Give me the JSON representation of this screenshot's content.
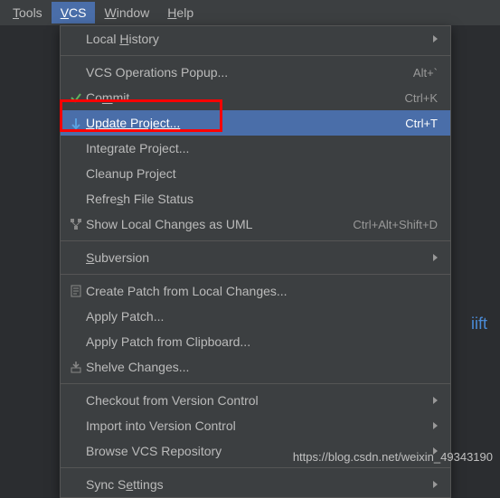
{
  "menubar": {
    "tools": "Tools",
    "vcs": "VCS",
    "window": "Window",
    "help": "Help"
  },
  "menu": {
    "local_history": "Local History",
    "vcs_ops_popup": "VCS Operations Popup...",
    "vcs_ops_popup_sc": "Alt+`",
    "commit": "Commit...",
    "commit_sc": "Ctrl+K",
    "update_project": "Update Project...",
    "update_project_sc": "Ctrl+T",
    "integrate_project": "Integrate Project...",
    "cleanup_project": "Cleanup Project",
    "refresh_file_status": "Refresh File Status",
    "show_local_changes": "Show Local Changes as UML",
    "show_local_changes_sc": "Ctrl+Alt+Shift+D",
    "subversion": "Subversion",
    "create_patch": "Create Patch from Local Changes...",
    "apply_patch": "Apply Patch...",
    "apply_patch_clipboard": "Apply Patch from Clipboard...",
    "shelve_changes": "Shelve Changes...",
    "checkout_vc": "Checkout from Version Control",
    "import_vc": "Import into Version Control",
    "browse_vcs_repo": "Browse VCS Repository",
    "sync_settings": "Sync Settings"
  },
  "bg_text": "iift",
  "watermark": "https://blog.csdn.net/weixin_49343190"
}
